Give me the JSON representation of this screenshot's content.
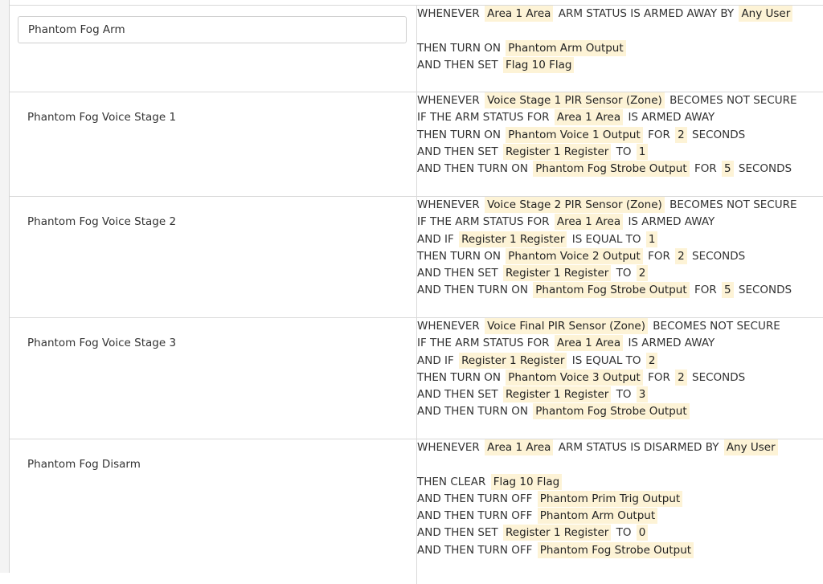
{
  "rules": [
    {
      "name": "Phantom Fog Arm",
      "editable": true,
      "lines": [
        [
          {
            "t": "kw",
            "v": "WHENEVER"
          },
          {
            "t": "tok",
            "v": "Area 1 Area"
          },
          {
            "t": "kw",
            "v": "ARM STATUS IS ARMED AWAY BY"
          },
          {
            "t": "tok",
            "v": "Any User"
          }
        ],
        [],
        [
          {
            "t": "kw",
            "v": "THEN TURN ON"
          },
          {
            "t": "tok",
            "v": "Phantom Arm Output"
          }
        ],
        [
          {
            "t": "kw",
            "v": "AND THEN SET"
          },
          {
            "t": "tok",
            "v": "Flag 10 Flag"
          }
        ]
      ]
    },
    {
      "name": "Phantom Fog Voice Stage 1",
      "editable": false,
      "lines": [
        [
          {
            "t": "kw",
            "v": "WHENEVER"
          },
          {
            "t": "tok",
            "v": "Voice Stage 1 PIR Sensor (Zone)"
          },
          {
            "t": "kw",
            "v": "BECOMES NOT SECURE"
          }
        ],
        [
          {
            "t": "kw",
            "v": "IF THE ARM STATUS FOR"
          },
          {
            "t": "tok",
            "v": "Area 1 Area"
          },
          {
            "t": "kw",
            "v": "IS ARMED AWAY"
          }
        ],
        [
          {
            "t": "kw",
            "v": "THEN TURN ON"
          },
          {
            "t": "tok",
            "v": "Phantom Voice 1 Output"
          },
          {
            "t": "kw",
            "v": "FOR"
          },
          {
            "t": "tok",
            "v": "2"
          },
          {
            "t": "kw",
            "v": "SECONDS"
          }
        ],
        [
          {
            "t": "kw",
            "v": "AND THEN SET"
          },
          {
            "t": "tok",
            "v": "Register 1 Register"
          },
          {
            "t": "kw",
            "v": "TO"
          },
          {
            "t": "tok",
            "v": "1"
          }
        ],
        [
          {
            "t": "kw",
            "v": "AND THEN TURN ON"
          },
          {
            "t": "tok",
            "v": "Phantom Fog Strobe Output"
          },
          {
            "t": "kw",
            "v": "FOR"
          },
          {
            "t": "tok",
            "v": "5"
          },
          {
            "t": "kw",
            "v": "SECONDS"
          }
        ]
      ]
    },
    {
      "name": "Phantom Fog Voice Stage 2",
      "editable": false,
      "lines": [
        [
          {
            "t": "kw",
            "v": "WHENEVER"
          },
          {
            "t": "tok",
            "v": "Voice Stage 2 PIR Sensor (Zone)"
          },
          {
            "t": "kw",
            "v": "BECOMES NOT SECURE"
          }
        ],
        [
          {
            "t": "kw",
            "v": "IF THE ARM STATUS FOR"
          },
          {
            "t": "tok",
            "v": "Area 1 Area"
          },
          {
            "t": "kw",
            "v": "IS ARMED AWAY"
          }
        ],
        [
          {
            "t": "kw",
            "v": "AND IF"
          },
          {
            "t": "tok",
            "v": "Register 1 Register"
          },
          {
            "t": "kw",
            "v": "IS EQUAL TO"
          },
          {
            "t": "tok",
            "v": "1"
          }
        ],
        [
          {
            "t": "kw",
            "v": "THEN TURN ON"
          },
          {
            "t": "tok",
            "v": "Phantom Voice 2 Output"
          },
          {
            "t": "kw",
            "v": "FOR"
          },
          {
            "t": "tok",
            "v": "2"
          },
          {
            "t": "kw",
            "v": "SECONDS"
          }
        ],
        [
          {
            "t": "kw",
            "v": "AND THEN SET"
          },
          {
            "t": "tok",
            "v": "Register 1 Register"
          },
          {
            "t": "kw",
            "v": "TO"
          },
          {
            "t": "tok",
            "v": "2"
          }
        ],
        [
          {
            "t": "kw",
            "v": "AND THEN TURN ON"
          },
          {
            "t": "tok",
            "v": "Phantom Fog Strobe Output"
          },
          {
            "t": "kw",
            "v": "FOR"
          },
          {
            "t": "tok",
            "v": "5"
          },
          {
            "t": "kw",
            "v": "SECONDS"
          }
        ]
      ]
    },
    {
      "name": "Phantom Fog Voice Stage 3",
      "editable": false,
      "lines": [
        [
          {
            "t": "kw",
            "v": "WHENEVER"
          },
          {
            "t": "tok",
            "v": "Voice Final PIR Sensor (Zone)"
          },
          {
            "t": "kw",
            "v": "BECOMES NOT SECURE"
          }
        ],
        [
          {
            "t": "kw",
            "v": "IF THE ARM STATUS FOR"
          },
          {
            "t": "tok",
            "v": "Area 1 Area"
          },
          {
            "t": "kw",
            "v": "IS ARMED AWAY"
          }
        ],
        [
          {
            "t": "kw",
            "v": "AND IF"
          },
          {
            "t": "tok",
            "v": "Register 1 Register"
          },
          {
            "t": "kw",
            "v": "IS EQUAL TO"
          },
          {
            "t": "tok",
            "v": "2"
          }
        ],
        [
          {
            "t": "kw",
            "v": "THEN TURN ON"
          },
          {
            "t": "tok",
            "v": "Phantom Voice 3 Output"
          },
          {
            "t": "kw",
            "v": "FOR"
          },
          {
            "t": "tok",
            "v": "2"
          },
          {
            "t": "kw",
            "v": "SECONDS"
          }
        ],
        [
          {
            "t": "kw",
            "v": "AND THEN SET"
          },
          {
            "t": "tok",
            "v": "Register 1 Register"
          },
          {
            "t": "kw",
            "v": "TO"
          },
          {
            "t": "tok",
            "v": "3"
          }
        ],
        [
          {
            "t": "kw",
            "v": "AND THEN TURN ON"
          },
          {
            "t": "tok",
            "v": "Phantom Fog Strobe Output"
          }
        ]
      ]
    },
    {
      "name": "Phantom Fog Disarm",
      "editable": false,
      "lines": [
        [
          {
            "t": "kw",
            "v": "WHENEVER"
          },
          {
            "t": "tok",
            "v": "Area 1 Area"
          },
          {
            "t": "kw",
            "v": "ARM STATUS IS DISARMED BY"
          },
          {
            "t": "tok",
            "v": "Any User"
          }
        ],
        [],
        [
          {
            "t": "kw",
            "v": "THEN CLEAR"
          },
          {
            "t": "tok",
            "v": "Flag 10 Flag"
          }
        ],
        [
          {
            "t": "kw",
            "v": "AND THEN TURN OFF"
          },
          {
            "t": "tok",
            "v": "Phantom Prim Trig Output"
          }
        ],
        [
          {
            "t": "kw",
            "v": "AND THEN TURN OFF"
          },
          {
            "t": "tok",
            "v": "Phantom Arm Output"
          }
        ],
        [
          {
            "t": "kw",
            "v": "AND THEN SET"
          },
          {
            "t": "tok",
            "v": "Register 1 Register"
          },
          {
            "t": "kw",
            "v": "TO"
          },
          {
            "t": "tok",
            "v": "0"
          }
        ],
        [
          {
            "t": "kw",
            "v": "AND THEN TURN OFF"
          },
          {
            "t": "tok",
            "v": "Phantom Fog Strobe Output"
          }
        ]
      ]
    }
  ]
}
